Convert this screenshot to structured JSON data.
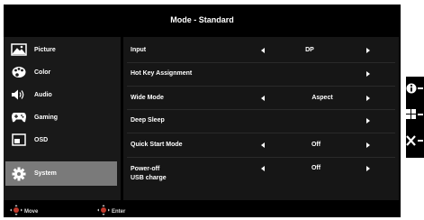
{
  "title": "Mode - Standard",
  "menu": [
    {
      "label": "Picture",
      "icon": "picture-icon"
    },
    {
      "label": "Color",
      "icon": "palette-icon"
    },
    {
      "label": "Audio",
      "icon": "speaker-icon"
    },
    {
      "label": "Gaming",
      "icon": "gamepad-icon"
    },
    {
      "label": "OSD",
      "icon": "osd-window-icon"
    },
    {
      "label": "System",
      "icon": "gear-icon",
      "active": true
    }
  ],
  "settings": [
    {
      "label": "Input",
      "value": "DP"
    },
    {
      "label": "Hot Key Assignment",
      "value": ""
    },
    {
      "label": "Wide Mode",
      "value": "Aspect"
    },
    {
      "label": "Deep Sleep",
      "value": ""
    },
    {
      "label": "Quick Start Mode",
      "value": "Off"
    },
    {
      "label_line1": "Power-off",
      "label_line2": "USB charge",
      "value": "Off"
    }
  ],
  "footer": {
    "move_label": "Move",
    "enter_label": "Enter"
  },
  "side_buttons": [
    "info-icon",
    "grid-menu-icon",
    "close-icon"
  ],
  "colors": {
    "panel": "#161616",
    "selected": "#7a7a7a",
    "text": "#ffffff"
  }
}
